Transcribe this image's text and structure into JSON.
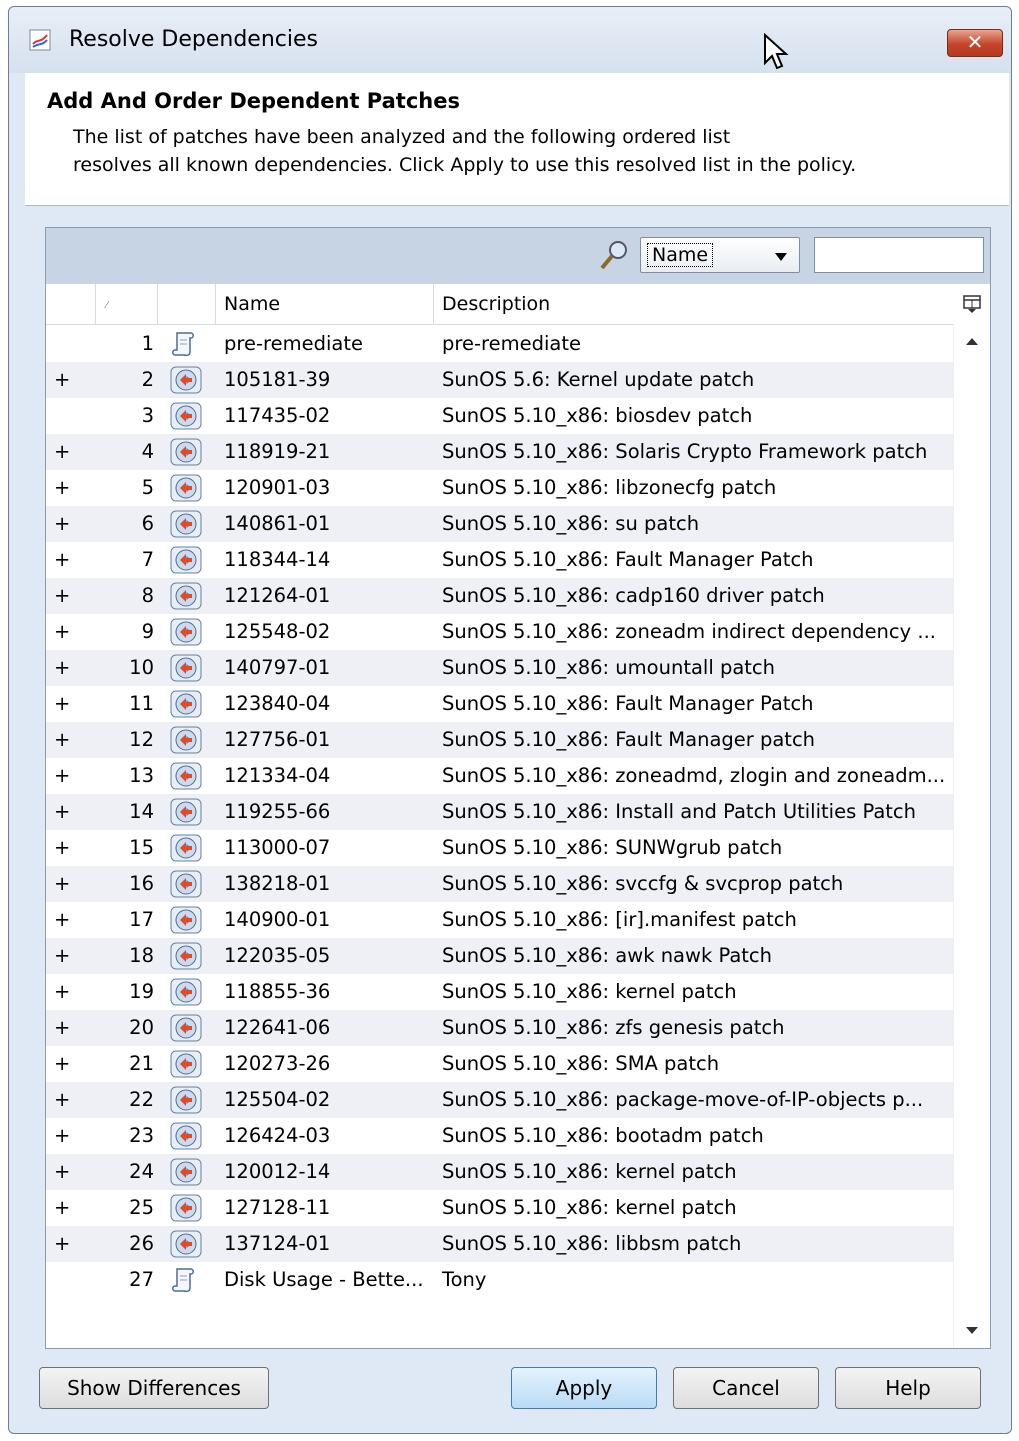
{
  "window": {
    "title": "Resolve Dependencies",
    "close_label": "✕"
  },
  "header": {
    "title": "Add And Order Dependent Patches",
    "description_line1": "The list of patches have been analyzed and the following ordered list",
    "description_line2": "resolves all known dependencies. Click Apply to use this resolved list in the policy."
  },
  "search": {
    "field_selected": "Name",
    "query": ""
  },
  "columns": {
    "sort_mark": "⁄",
    "name": "Name",
    "description": "Description"
  },
  "rows": [
    {
      "expand": "",
      "num": "1",
      "icon": "script-icon",
      "name": "pre-remediate",
      "desc": "pre-remediate"
    },
    {
      "expand": "+",
      "num": "2",
      "icon": "patch-disc-icon",
      "name": "105181-39",
      "desc": "SunOS 5.6: Kernel update patch"
    },
    {
      "expand": "",
      "num": "3",
      "icon": "patch-disc-icon",
      "name": "117435-02",
      "desc": "SunOS 5.10_x86: biosdev patch"
    },
    {
      "expand": "+",
      "num": "4",
      "icon": "patch-disc-icon",
      "name": "118919-21",
      "desc": "SunOS 5.10_x86: Solaris Crypto Framework patch"
    },
    {
      "expand": "+",
      "num": "5",
      "icon": "patch-disc-icon",
      "name": "120901-03",
      "desc": "SunOS 5.10_x86: libzonecfg patch"
    },
    {
      "expand": "+",
      "num": "6",
      "icon": "patch-disc-icon",
      "name": "140861-01",
      "desc": "SunOS 5.10_x86: su patch"
    },
    {
      "expand": "+",
      "num": "7",
      "icon": "patch-disc-icon",
      "name": "118344-14",
      "desc": "SunOS 5.10_x86: Fault Manager Patch"
    },
    {
      "expand": "+",
      "num": "8",
      "icon": "patch-disc-icon",
      "name": "121264-01",
      "desc": "SunOS 5.10_x86: cadp160 driver patch"
    },
    {
      "expand": "+",
      "num": "9",
      "icon": "patch-disc-icon",
      "name": "125548-02",
      "desc": "SunOS 5.10_x86: zoneadm indirect dependency ..."
    },
    {
      "expand": "+",
      "num": "10",
      "icon": "patch-disc-icon",
      "name": "140797-01",
      "desc": "SunOS 5.10_x86: umountall patch"
    },
    {
      "expand": "+",
      "num": "11",
      "icon": "patch-disc-icon",
      "name": "123840-04",
      "desc": "SunOS 5.10_x86: Fault Manager Patch"
    },
    {
      "expand": "+",
      "num": "12",
      "icon": "patch-disc-icon",
      "name": "127756-01",
      "desc": "SunOS 5.10_x86: Fault Manager patch"
    },
    {
      "expand": "+",
      "num": "13",
      "icon": "patch-disc-icon",
      "name": "121334-04",
      "desc": "SunOS 5.10_x86: zoneadmd, zlogin and zoneadm..."
    },
    {
      "expand": "+",
      "num": "14",
      "icon": "patch-disc-icon",
      "name": "119255-66",
      "desc": "SunOS 5.10_x86: Install and Patch Utilities Patch"
    },
    {
      "expand": "+",
      "num": "15",
      "icon": "patch-disc-icon",
      "name": "113000-07",
      "desc": "SunOS 5.10_x86: SUNWgrub patch"
    },
    {
      "expand": "+",
      "num": "16",
      "icon": "patch-disc-icon",
      "name": "138218-01",
      "desc": "SunOS 5.10_x86: svccfg & svcprop patch"
    },
    {
      "expand": "+",
      "num": "17",
      "icon": "patch-disc-icon",
      "name": "140900-01",
      "desc": "SunOS 5.10_x86: [ir].manifest patch"
    },
    {
      "expand": "+",
      "num": "18",
      "icon": "patch-disc-icon",
      "name": "122035-05",
      "desc": "SunOS 5.10_x86: awk nawk Patch"
    },
    {
      "expand": "+",
      "num": "19",
      "icon": "patch-disc-icon",
      "name": "118855-36",
      "desc": "SunOS 5.10_x86: kernel patch"
    },
    {
      "expand": "+",
      "num": "20",
      "icon": "patch-disc-icon",
      "name": "122641-06",
      "desc": "SunOS 5.10_x86: zfs genesis patch"
    },
    {
      "expand": "+",
      "num": "21",
      "icon": "patch-disc-icon",
      "name": "120273-26",
      "desc": "SunOS 5.10_x86: SMA patch"
    },
    {
      "expand": "+",
      "num": "22",
      "icon": "patch-disc-icon",
      "name": "125504-02",
      "desc": "SunOS 5.10_x86: package-move-of-IP-objects p..."
    },
    {
      "expand": "+",
      "num": "23",
      "icon": "patch-disc-icon",
      "name": "126424-03",
      "desc": "SunOS 5.10_x86: bootadm patch"
    },
    {
      "expand": "+",
      "num": "24",
      "icon": "patch-disc-icon",
      "name": "120012-14",
      "desc": "SunOS 5.10_x86: kernel patch"
    },
    {
      "expand": "+",
      "num": "25",
      "icon": "patch-disc-icon",
      "name": "127128-11",
      "desc": "SunOS 5.10_x86: kernel patch"
    },
    {
      "expand": "+",
      "num": "26",
      "icon": "patch-disc-icon",
      "name": "137124-01",
      "desc": "SunOS 5.10_x86: libbsm patch"
    },
    {
      "expand": "",
      "num": "27",
      "icon": "script-icon",
      "name": "Disk Usage - Bette...",
      "desc": "Tony"
    }
  ],
  "buttons": {
    "show_differences": "Show Differences",
    "apply": "Apply",
    "cancel": "Cancel",
    "help": "Help"
  },
  "colors": {
    "accent": "#3c7fb1",
    "close": "#c6442a",
    "toolbar": "#c6d4e4",
    "row_alt": "#eef0f5"
  }
}
